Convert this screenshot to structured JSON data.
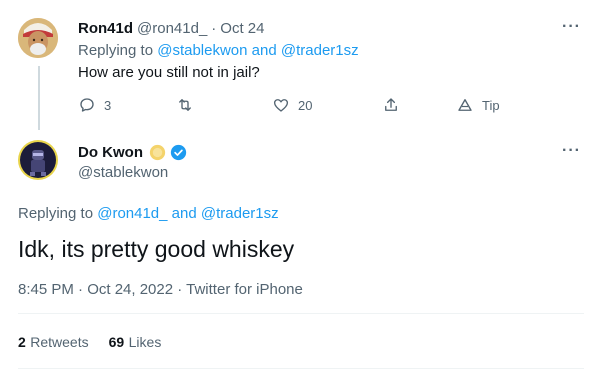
{
  "reply_tweet": {
    "display_name": "Ron41d",
    "handle": "@ron41d_",
    "separator": "·",
    "date": "Oct 24",
    "replying_prefix": "Replying to",
    "replying_user_1": "@stablekwon",
    "replying_and": "and",
    "replying_user_2": "@trader1sz",
    "text": "How are you still not in jail?",
    "reply_count": "3",
    "retweet_count": "",
    "like_count": "20",
    "tip_label": "Tip",
    "more_label": "···"
  },
  "main_tweet": {
    "display_name": "Do Kwon",
    "handle": "@stablekwon",
    "more_label": "···",
    "replying_prefix": "Replying to",
    "replying_user_1": "@ron41d_",
    "replying_and": "and",
    "replying_user_2": "@trader1sz",
    "text": "Idk, its pretty good whiskey",
    "timestamp": "8:45 PM · Oct 24, 2022 · Twitter for iPhone",
    "retweets_count": "2",
    "retweets_label": "Retweets",
    "likes_count": "69",
    "likes_label": "Likes"
  },
  "colors": {
    "accent": "#1d9bf0",
    "muted": "#536471",
    "text": "#0f1419",
    "verified": "#1d9bf0",
    "emoji_gold": "#f4d36b"
  },
  "icons": [
    "reply-icon",
    "retweet-icon",
    "like-icon",
    "share-icon",
    "tip-icon",
    "verified-badge-icon",
    "coin-emoji-icon"
  ]
}
